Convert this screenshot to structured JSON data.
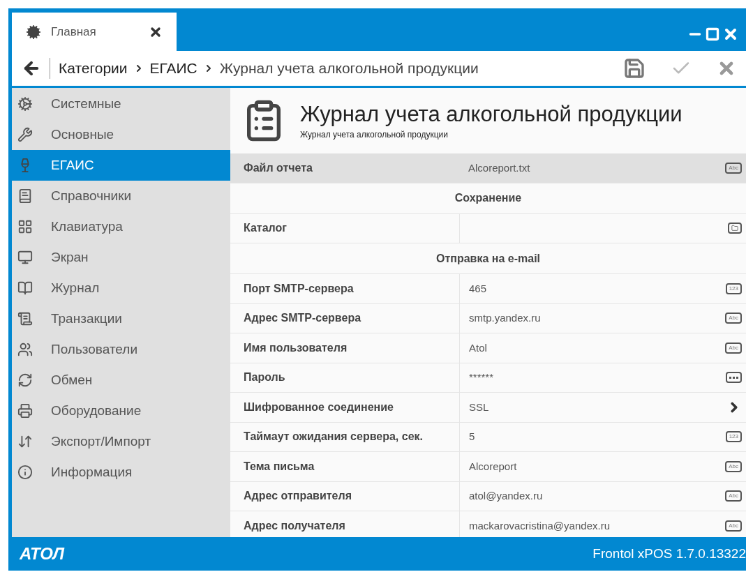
{
  "tab": {
    "label": "Главная",
    "selected": true
  },
  "breadcrumb": {
    "items": [
      "Категории",
      "ЕГАИС"
    ],
    "current": "Журнал учета алкогольной продукции"
  },
  "sidebar": {
    "items": [
      {
        "label": "Системные",
        "selected": false
      },
      {
        "label": "Основные",
        "selected": false
      },
      {
        "label": "ЕГАИС",
        "selected": true
      },
      {
        "label": "Справочники",
        "selected": false
      },
      {
        "label": "Клавиатура",
        "selected": false
      },
      {
        "label": "Экран",
        "selected": false
      },
      {
        "label": "Журнал",
        "selected": false
      },
      {
        "label": "Транзакции",
        "selected": false
      },
      {
        "label": "Пользователи",
        "selected": false
      },
      {
        "label": "Обмен",
        "selected": false
      },
      {
        "label": "Оборудование",
        "selected": false
      },
      {
        "label": "Экспорт/Импорт",
        "selected": false
      },
      {
        "label": "Информация",
        "selected": false
      }
    ]
  },
  "page": {
    "title": "Журнал учета алкогольной продукции",
    "subtitle": "Журнал учета алкогольной продукции"
  },
  "rows": [
    {
      "kind": "text",
      "label": "Файл отчета",
      "value": "Alcoreport.txt",
      "badge": "Abc",
      "selected": true
    },
    {
      "kind": "section",
      "label": "Сохранение"
    },
    {
      "kind": "folder",
      "label": "Каталог",
      "selected": false
    },
    {
      "kind": "section",
      "label": "Отправка на e-mail"
    },
    {
      "kind": "text",
      "label": "Порт SMTP-сервера",
      "value": "465",
      "badge": "123",
      "selected": false
    },
    {
      "kind": "text",
      "label": "Адрес SMTP-сервера",
      "value": "smtp.yandex.ru",
      "badge": "Abc",
      "selected": false
    },
    {
      "kind": "text",
      "label": "Имя пользователя",
      "value": "Atol",
      "badge": "Abc",
      "selected": false
    },
    {
      "kind": "password",
      "label": "Пароль",
      "value": "******",
      "selected": false
    },
    {
      "kind": "choice",
      "label": "Шифрованное соединение",
      "value": "SSL",
      "selected": false
    },
    {
      "kind": "text",
      "label": "Таймаут ожидания сервера, сек.",
      "value": "5",
      "badge": "123",
      "selected": false
    },
    {
      "kind": "text",
      "label": "Тема письма",
      "value": "Alcoreport",
      "badge": "Abc",
      "selected": false
    },
    {
      "kind": "text",
      "label": "Адрес отправителя",
      "value": "atol@yandex.ru",
      "badge": "Abc",
      "selected": false
    },
    {
      "kind": "text",
      "label": "Адрес получателя",
      "value": "mackarovacristina@yandex.ru",
      "badge": "Abc",
      "selected": false
    }
  ],
  "footer": {
    "logo": "АТОЛ",
    "version": "Frontol xPOS 1.7.0.13322"
  }
}
